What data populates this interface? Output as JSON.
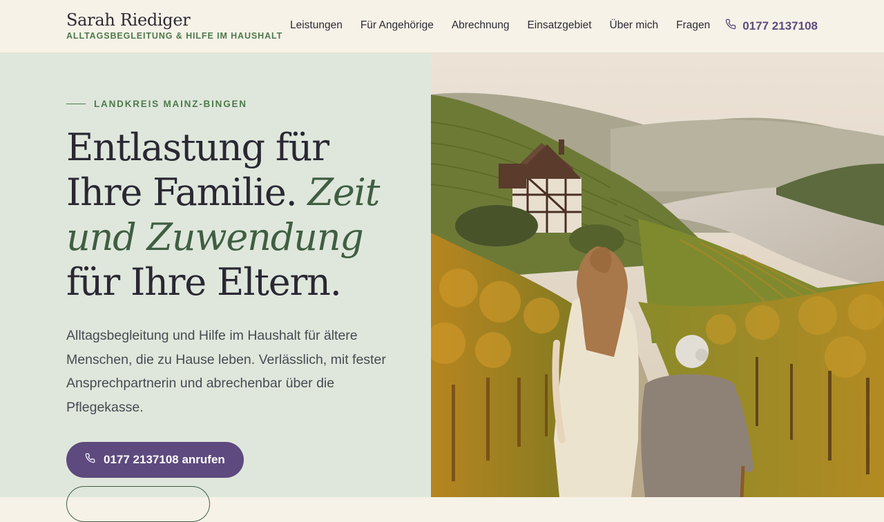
{
  "brand": {
    "name": "Sarah Riediger",
    "tagline": "ALLTAGSBEGLEITUNG & HILFE IM HAUSHALT"
  },
  "nav": {
    "items": [
      "Leistungen",
      "Für Angehörige",
      "Abrechnung",
      "Einsatzgebiet",
      "Über mich",
      "Fragen"
    ]
  },
  "header": {
    "phone": "0177 2137108",
    "phone_icon": "phone-icon"
  },
  "hero": {
    "eyebrow": "LANDKREIS MAINZ-BINGEN",
    "headline_part1": "Entlastung für Ihre Familie. ",
    "headline_emphasis": "Zeit und Zuwendung",
    "headline_part2": " für Ihre Eltern.",
    "lead": "Alltagsbegleitung und Hilfe im Haushalt für ältere Menschen, die zu Hause leben. Verlässlich, mit fester Ansprechpartnerin und abrechenbar über die Pflegekasse.",
    "cta_label": "0177 2137108 anrufen",
    "image_subject": "vineyard-river-photo"
  },
  "colors": {
    "accent": "#5e4a7e",
    "green": "#3f5e42",
    "panel": "#dfe7dc",
    "header_bg": "#f6f2e8"
  }
}
